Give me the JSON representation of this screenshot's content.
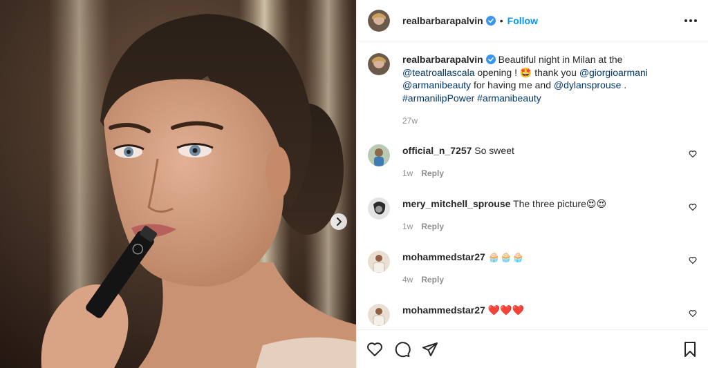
{
  "post": {
    "username": "realbarbarapalvin",
    "follow_label": "Follow",
    "dot": "•",
    "caption": {
      "t1": "Beautiful night in Milan at the",
      "mention1": "@teatroallascala",
      "t2": "opening ! 🤩 thank you",
      "mention2": "@giorgioarmani",
      "mention3": "@armanibeauty",
      "t3": "for having me and",
      "mention4": "@dylansprouse",
      "t4": ".",
      "hashtag1": "#armanilipPower",
      "hashtag2": "#armanibeauty",
      "age": "27w"
    }
  },
  "comments": [
    {
      "user": "official_n_7257",
      "text": "So sweet",
      "age": "1w",
      "reply": "Reply"
    },
    {
      "user": "mery_mitchell_sprouse",
      "text": "The three picture😍😍",
      "age": "1w",
      "reply": "Reply"
    },
    {
      "user": "mohammedstar27",
      "text": "🧁🧁🧁",
      "age": "4w",
      "reply": "Reply"
    },
    {
      "user": "mohammedstar27",
      "text": "❤️❤️❤️",
      "age": "",
      "reply": ""
    }
  ],
  "icons": {
    "verified": "verified-badge-icon",
    "more": "more-options-icon",
    "next": "chevron-right-icon",
    "like": "heart-icon",
    "comment": "comment-icon",
    "share": "send-icon",
    "save": "bookmark-icon"
  },
  "colors": {
    "accent": "#0095f6",
    "link": "#00376b",
    "muted": "#8e8e8e",
    "text": "#262626"
  }
}
